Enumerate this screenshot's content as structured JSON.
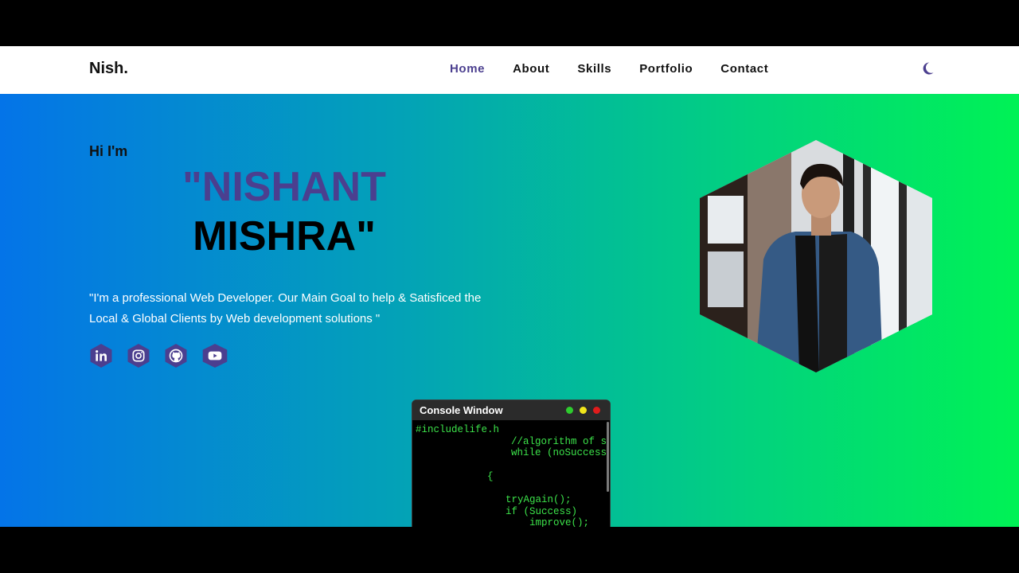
{
  "nav": {
    "brand": "Nish.",
    "links": [
      {
        "label": "Home",
        "active": true
      },
      {
        "label": "About"
      },
      {
        "label": "Skills"
      },
      {
        "label": "Portfolio"
      },
      {
        "label": "Contact"
      }
    ],
    "theme_toggle_icon": "moon-icon"
  },
  "hero": {
    "greeting": "Hi I'm",
    "name_first": "\"NISHANT",
    "name_last": "MISHRA\"",
    "tagline": "\"I'm a professional Web Developer. Our Main Goal to help & Satisficed the Local & Global Clients by Web development solutions \"",
    "socials": [
      {
        "icon": "linkedin-icon"
      },
      {
        "icon": "instagram-icon"
      },
      {
        "icon": "github-icon"
      },
      {
        "icon": "youtube-icon"
      }
    ],
    "photo": "profile-photo"
  },
  "console": {
    "title": "Console Window",
    "lines": [
      "#includelife.h",
      "//algorithm of s",
      "while (noSuccess",
      "{",
      "tryAgain();",
      "if (Success)",
      "improve();"
    ]
  },
  "colors": {
    "accent": "#4b3f8f",
    "gradient_start": "#0474e8",
    "gradient_end": "#00f255",
    "code_green": "#3ce34a"
  }
}
